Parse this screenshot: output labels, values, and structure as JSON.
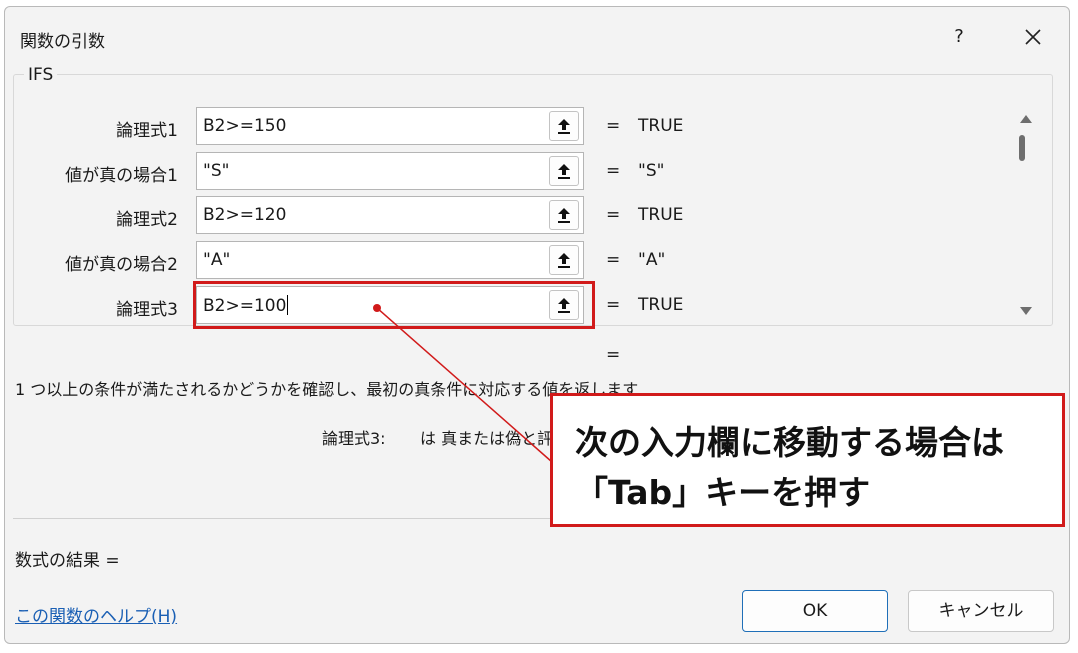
{
  "window": {
    "title": "関数の引数",
    "help_label": "?"
  },
  "function_name": "IFS",
  "arguments": [
    {
      "label": "論理式1",
      "value": "B2>=150",
      "result": "TRUE"
    },
    {
      "label": "値が真の場合1",
      "value": "\"S\"",
      "result": "\"S\""
    },
    {
      "label": "論理式2",
      "value": "B2>=120",
      "result": "TRUE"
    },
    {
      "label": "値が真の場合2",
      "value": "\"A\"",
      "result": "\"A\""
    },
    {
      "label": "論理式3",
      "value": "B2>=100",
      "result": "TRUE"
    }
  ],
  "equals": "=",
  "description": "1 つ以上の条件が満たされるかどうかを確認し、最初の真条件に対応する値を返します",
  "argument_help": {
    "label": "論理式3:",
    "text": "は 真または偽と評"
  },
  "formula_result": "数式の結果 =",
  "help_link": "この関数のヘルプ(H)",
  "buttons": {
    "ok": "OK",
    "cancel": "キャンセル"
  },
  "callout": {
    "line1": "次の入力欄に移動する場合は",
    "line2": "「Tab」キーを押す"
  },
  "colors": {
    "annotation": "#d11a1a",
    "link": "#1a5fb4",
    "dialog_bg": "#f3f3f3"
  }
}
